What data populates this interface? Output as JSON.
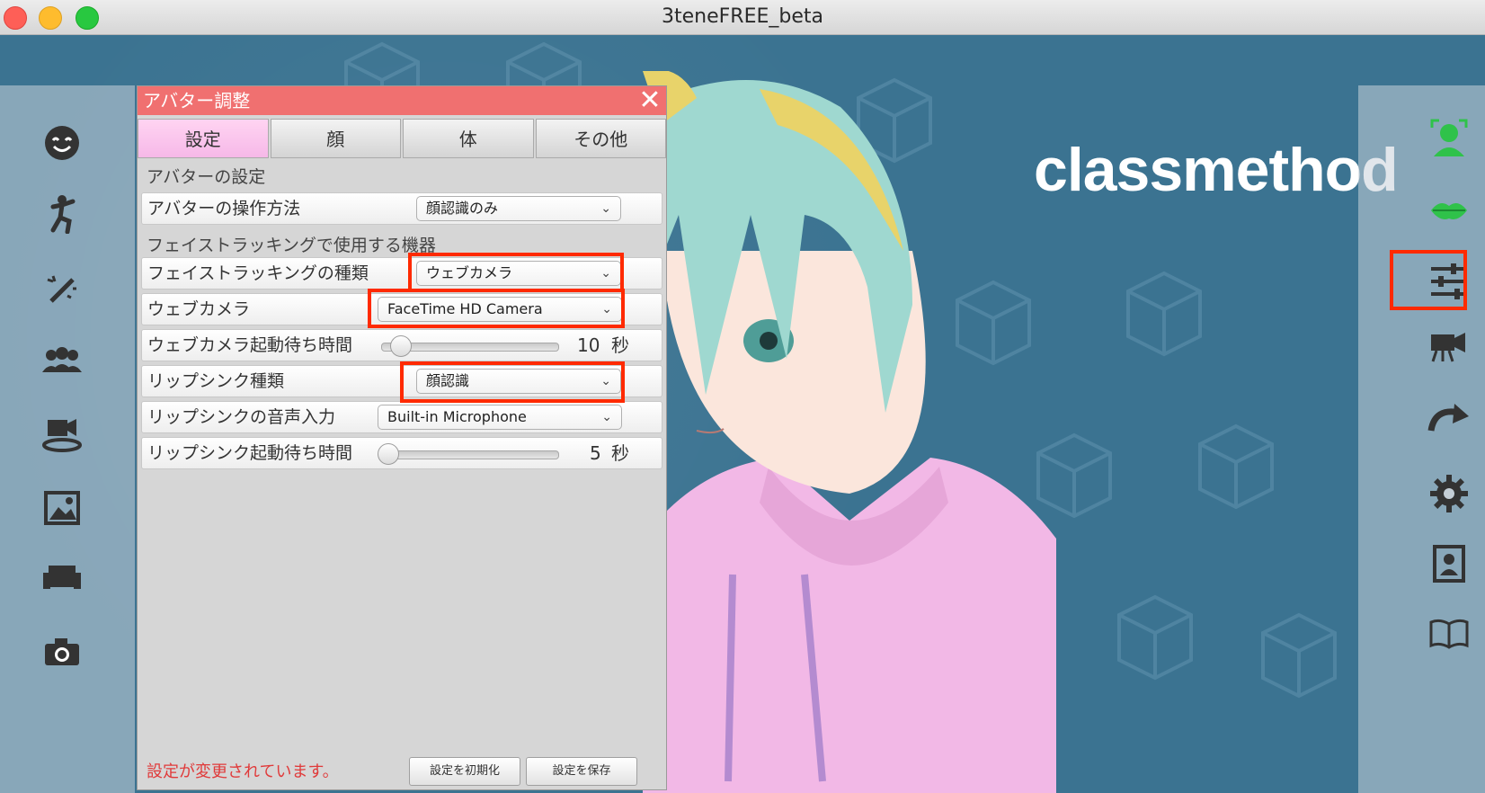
{
  "window": {
    "title": "3teneFREE_beta"
  },
  "brand": {
    "logo_text": "classmethod"
  },
  "left_sidebar": {
    "icons": [
      "face-icon",
      "pose-icon",
      "effect-wand-icon",
      "group-icon",
      "camera-stage-icon",
      "image-icon",
      "sofa-icon",
      "camera-icon"
    ]
  },
  "right_sidebar": {
    "icons": [
      "face-tracking-icon",
      "lips-icon",
      "sliders-icon",
      "video-camera-icon",
      "redo-icon",
      "gear-icon",
      "portrait-icon",
      "book-icon"
    ]
  },
  "panel": {
    "title": "アバター調整",
    "close": "✕",
    "tabs": [
      "設定",
      "顔",
      "体",
      "その他"
    ],
    "active_tab": "設定",
    "section_avatar": "アバターの設定",
    "rows": {
      "control_method": {
        "label": "アバターの操作方法",
        "value": "顔認識のみ"
      },
      "section_devices": "フェイストラッキングで使用する機器",
      "tracking_type": {
        "label": "フェイストラッキングの種類",
        "value": "ウェブカメラ"
      },
      "webcam": {
        "label": "ウェブカメラ",
        "value": "FaceTime HD Camera"
      },
      "webcam_wait": {
        "label": "ウェブカメラ起動待ち時間",
        "value": "10",
        "unit": "秒",
        "fraction": 0.1
      },
      "lipsync_type": {
        "label": "リップシンク種類",
        "value": "顔認識"
      },
      "lipsync_mic": {
        "label": "リップシンクの音声入力",
        "value": "Built-in Microphone"
      },
      "lipsync_wait": {
        "label": "リップシンク起動待ち時間",
        "value": "5",
        "unit": "秒",
        "fraction": 0.0
      }
    },
    "footer": {
      "message": "設定が変更されています。",
      "reset_button": "設定を初期化",
      "save_button": "設定を保存"
    }
  },
  "colors": {
    "accent_red": "#ff2a00",
    "panel_header": "#f07070",
    "tab_active": "#f6b8e8"
  }
}
